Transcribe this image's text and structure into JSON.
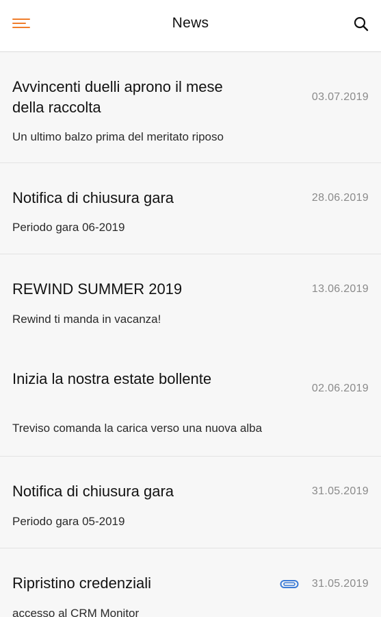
{
  "header": {
    "title": "News",
    "menu_icon": "hamburger-menu-icon",
    "search_icon": "search-icon",
    "accent_color": "#f07d2b"
  },
  "news": [
    {
      "title": "Avvincenti duelli aprono il mese della raccolta",
      "date": "03.07.2019",
      "subtitle": "Un ultimo balzo prima del meritato riposo"
    },
    {
      "title": "Notifica di chiusura gara",
      "date": "28.06.2019",
      "subtitle": "Periodo gara 06-2019"
    },
    {
      "title": "REWIND SUMMER 2019",
      "date": "13.06.2019",
      "subtitle": "Rewind ti manda in vacanza!"
    },
    {
      "title": "Inizia la nostra estate bollente",
      "date": "02.06.2019",
      "subtitle": "Treviso comanda la carica verso una nuova alba"
    },
    {
      "title": "Notifica di chiusura gara",
      "date": "31.05.2019",
      "subtitle": "Periodo gara 05-2019"
    },
    {
      "title": "Ripristino credenziali",
      "date": "31.05.2019",
      "subtitle": "accesso al CRM Monitor",
      "attachment_icon": "paperclip-icon"
    }
  ]
}
